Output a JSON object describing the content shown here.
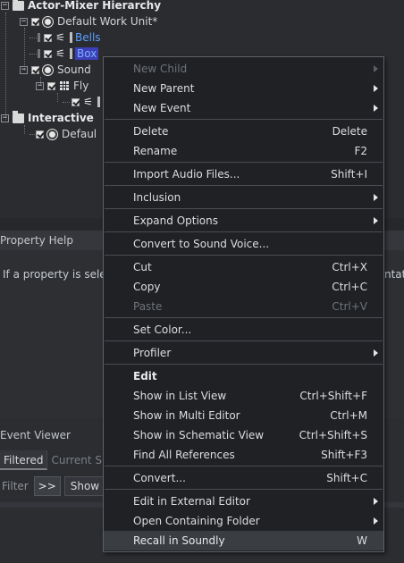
{
  "tree": {
    "rows": [
      {
        "label": "Actor-Mixer Hierarchy"
      },
      {
        "label": "Default Work Unit*"
      },
      {
        "label": "Bells"
      },
      {
        "label": "Box"
      },
      {
        "label": "Sound"
      },
      {
        "label": "Fly"
      },
      {
        "label": "Interactive"
      },
      {
        "label": "Defaul"
      }
    ]
  },
  "property_help": {
    "title": "Property Help",
    "text": "If a property is sele",
    "tail": "ntat"
  },
  "event_viewer": {
    "title": "Event Viewer",
    "tabs": [
      "Filtered",
      "Current S"
    ],
    "filter_label": "Filter",
    "filter_button": ">>",
    "show_label": "Show"
  },
  "context_menu": {
    "items": [
      {
        "label": "New Child",
        "shortcut": "",
        "submenu": true,
        "disabled": true
      },
      {
        "label": "New Parent",
        "shortcut": "",
        "submenu": true
      },
      {
        "label": "New Event",
        "shortcut": "",
        "submenu": true
      },
      {
        "sep": true
      },
      {
        "label": "Delete",
        "shortcut": "Delete"
      },
      {
        "label": "Rename",
        "shortcut": "F2"
      },
      {
        "sep": true
      },
      {
        "label": "Import Audio Files...",
        "shortcut": "Shift+I"
      },
      {
        "sep": true
      },
      {
        "label": "Inclusion",
        "shortcut": "",
        "submenu": true
      },
      {
        "sep": true
      },
      {
        "label": "Expand Options",
        "shortcut": "",
        "submenu": true
      },
      {
        "sep": true
      },
      {
        "label": "Convert to Sound Voice...",
        "shortcut": ""
      },
      {
        "sep": true
      },
      {
        "label": "Cut",
        "shortcut": "Ctrl+X"
      },
      {
        "label": "Copy",
        "shortcut": "Ctrl+C"
      },
      {
        "label": "Paste",
        "shortcut": "Ctrl+V",
        "disabled": true
      },
      {
        "sep": true
      },
      {
        "label": "Set Color...",
        "shortcut": ""
      },
      {
        "sep": true
      },
      {
        "label": "Profiler",
        "shortcut": "",
        "submenu": true
      },
      {
        "sep": true
      },
      {
        "label": "Edit",
        "shortcut": "",
        "heading": true
      },
      {
        "label": "Show in List View",
        "shortcut": "Ctrl+Shift+F"
      },
      {
        "label": "Show in Multi Editor",
        "shortcut": "Ctrl+M"
      },
      {
        "label": "Show in Schematic View",
        "shortcut": "Ctrl+Shift+S"
      },
      {
        "label": "Find All References",
        "shortcut": "Shift+F3"
      },
      {
        "sep": true
      },
      {
        "label": "Convert...",
        "shortcut": "Shift+C"
      },
      {
        "sep": true
      },
      {
        "label": "Edit in External Editor",
        "shortcut": "",
        "submenu": true
      },
      {
        "label": "Open Containing Folder",
        "shortcut": "",
        "submenu": true
      },
      {
        "label": "Recall in Soundly",
        "shortcut": "W",
        "highlight": true
      }
    ]
  },
  "colors": {
    "link": "#5aa0ff",
    "selection": "#3c3fb8",
    "menu_bg": "#1f2124",
    "menu_highlight": "#3a3d42"
  }
}
